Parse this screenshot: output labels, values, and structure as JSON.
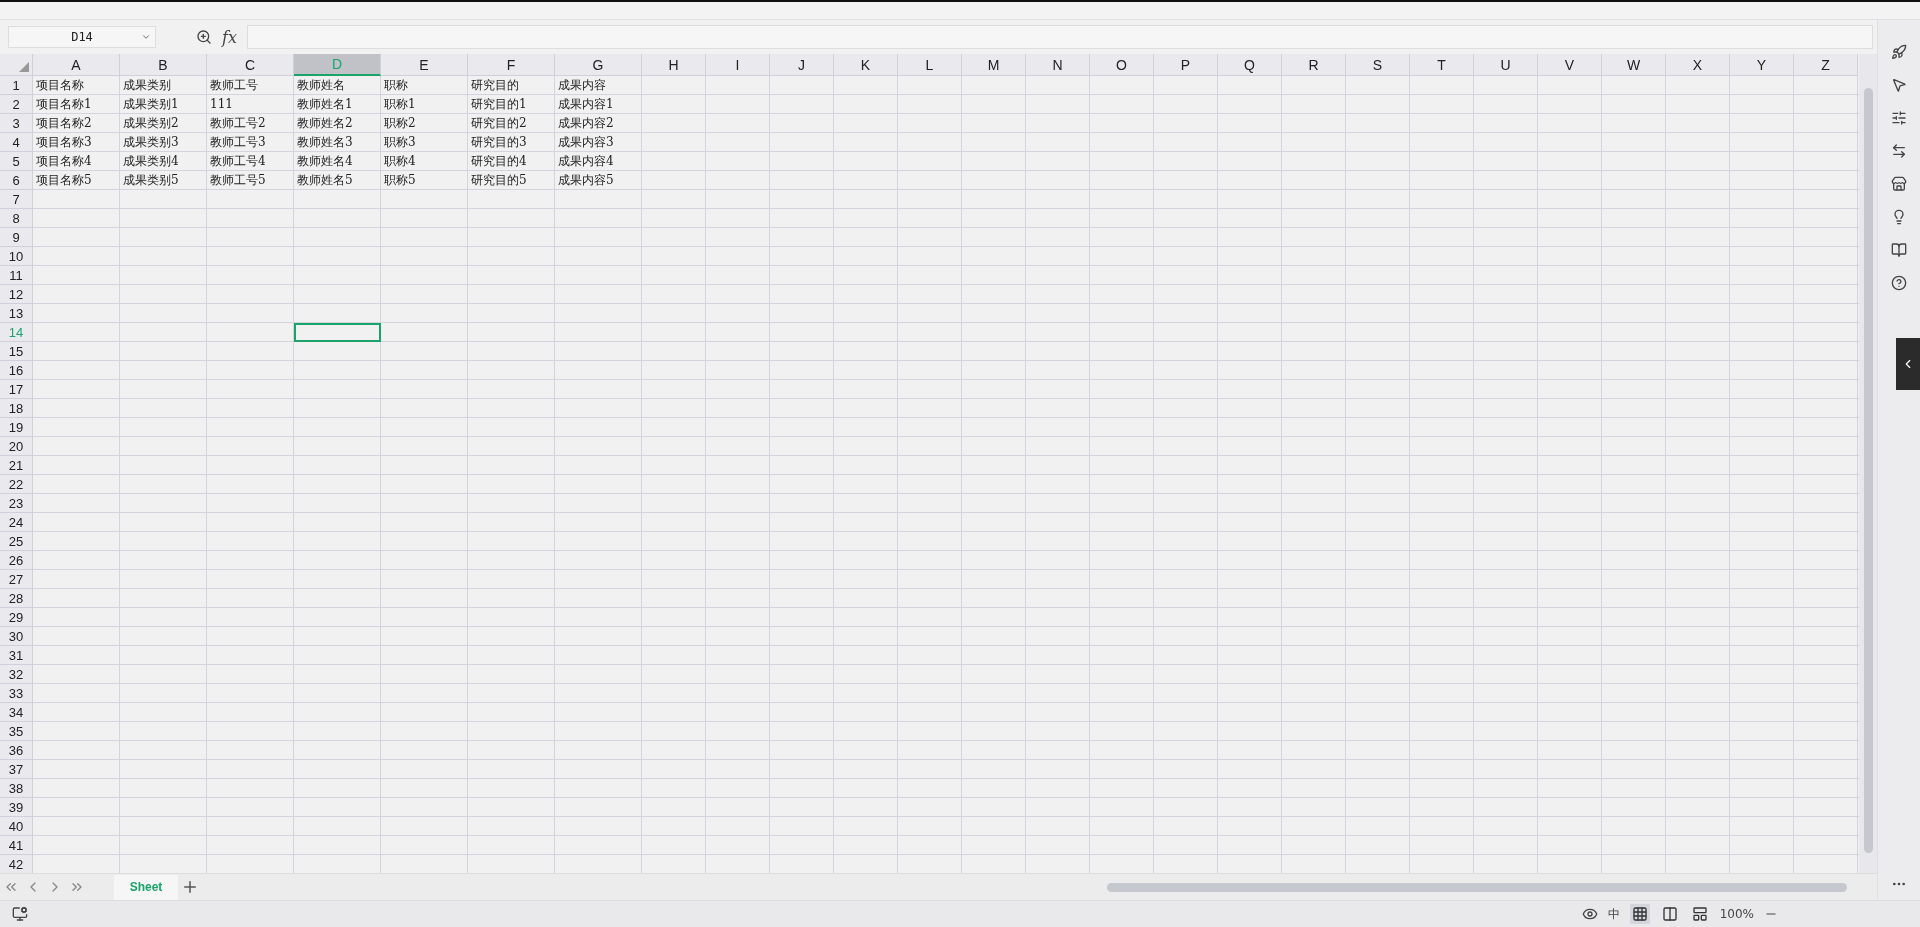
{
  "name_box": {
    "value": "D14"
  },
  "formula_bar": {
    "label": "fx"
  },
  "columns": [
    {
      "label": "A",
      "selected": false
    },
    {
      "label": "B",
      "selected": false
    },
    {
      "label": "C",
      "selected": false
    },
    {
      "label": "D",
      "selected": true
    },
    {
      "label": "E",
      "selected": false
    },
    {
      "label": "F",
      "selected": false
    },
    {
      "label": "G",
      "selected": false
    },
    {
      "label": "H",
      "selected": false
    },
    {
      "label": "I",
      "selected": false
    },
    {
      "label": "J",
      "selected": false
    },
    {
      "label": "K",
      "selected": false
    },
    {
      "label": "L",
      "selected": false
    },
    {
      "label": "M",
      "selected": false
    },
    {
      "label": "N",
      "selected": false
    },
    {
      "label": "O",
      "selected": false
    },
    {
      "label": "P",
      "selected": false
    },
    {
      "label": "Q",
      "selected": false
    },
    {
      "label": "R",
      "selected": false
    },
    {
      "label": "S",
      "selected": false
    },
    {
      "label": "T",
      "selected": false
    },
    {
      "label": "U",
      "selected": false
    },
    {
      "label": "V",
      "selected": false
    },
    {
      "label": "W",
      "selected": false
    },
    {
      "label": "X",
      "selected": false
    },
    {
      "label": "Y",
      "selected": false
    },
    {
      "label": "Z",
      "selected": false
    }
  ],
  "rows": [
    {
      "number": "1",
      "selected": false,
      "cells": [
        "项目名称",
        "成果类别",
        "教师工号",
        "教师姓名",
        "职称",
        "研究目的",
        "成果内容"
      ]
    },
    {
      "number": "2",
      "selected": false,
      "cells": [
        "项目名称1",
        "成果类别1",
        "111",
        "教师姓名1",
        "职称1",
        "研究目的1",
        "成果内容1"
      ]
    },
    {
      "number": "3",
      "selected": false,
      "cells": [
        "项目名称2",
        "成果类别2",
        "教师工号2",
        "教师姓名2",
        "职称2",
        "研究目的2",
        "成果内容2"
      ]
    },
    {
      "number": "4",
      "selected": false,
      "cells": [
        "项目名称3",
        "成果类别3",
        "教师工号3",
        "教师姓名3",
        "职称3",
        "研究目的3",
        "成果内容3"
      ]
    },
    {
      "number": "5",
      "selected": false,
      "cells": [
        "项目名称4",
        "成果类别4",
        "教师工号4",
        "教师姓名4",
        "职称4",
        "研究目的4",
        "成果内容4"
      ]
    },
    {
      "number": "6",
      "selected": false,
      "cells": [
        "项目名称5",
        "成果类别5",
        "教师工号5",
        "教师姓名5",
        "职称5",
        "研究目的5",
        "成果内容5"
      ]
    },
    {
      "number": "7",
      "selected": false
    },
    {
      "number": "8",
      "selected": false
    },
    {
      "number": "9",
      "selected": false
    },
    {
      "number": "10",
      "selected": false
    },
    {
      "number": "11",
      "selected": false
    },
    {
      "number": "12",
      "selected": false
    },
    {
      "number": "13",
      "selected": false
    },
    {
      "number": "14",
      "selected": true
    },
    {
      "number": "15",
      "selected": false
    },
    {
      "number": "16",
      "selected": false
    },
    {
      "number": "17",
      "selected": false
    },
    {
      "number": "18",
      "selected": false
    },
    {
      "number": "19",
      "selected": false
    },
    {
      "number": "20",
      "selected": false
    },
    {
      "number": "21",
      "selected": false
    },
    {
      "number": "22",
      "selected": false
    },
    {
      "number": "23",
      "selected": false
    },
    {
      "number": "24",
      "selected": false
    },
    {
      "number": "25",
      "selected": false
    },
    {
      "number": "26",
      "selected": false
    },
    {
      "number": "27",
      "selected": false
    },
    {
      "number": "28",
      "selected": false
    },
    {
      "number": "29",
      "selected": false
    },
    {
      "number": "30",
      "selected": false
    },
    {
      "number": "31",
      "selected": false
    },
    {
      "number": "32",
      "selected": false
    },
    {
      "number": "33",
      "selected": false
    },
    {
      "number": "34",
      "selected": false
    },
    {
      "number": "35",
      "selected": false
    },
    {
      "number": "36",
      "selected": false
    },
    {
      "number": "37",
      "selected": false
    },
    {
      "number": "38",
      "selected": false
    },
    {
      "number": "39",
      "selected": false
    },
    {
      "number": "40",
      "selected": false
    },
    {
      "number": "41",
      "selected": false
    },
    {
      "number": "42",
      "selected": false
    }
  ],
  "sheet_tabs": [
    {
      "label": "Sheet",
      "selected": true
    }
  ],
  "status_bar": {
    "input_mode": "中",
    "views": [
      {
        "kind": "normal",
        "selected": true
      },
      {
        "kind": "reading",
        "selected": false
      },
      {
        "kind": "pagebreak",
        "selected": false
      }
    ],
    "zoom": "100%"
  }
}
